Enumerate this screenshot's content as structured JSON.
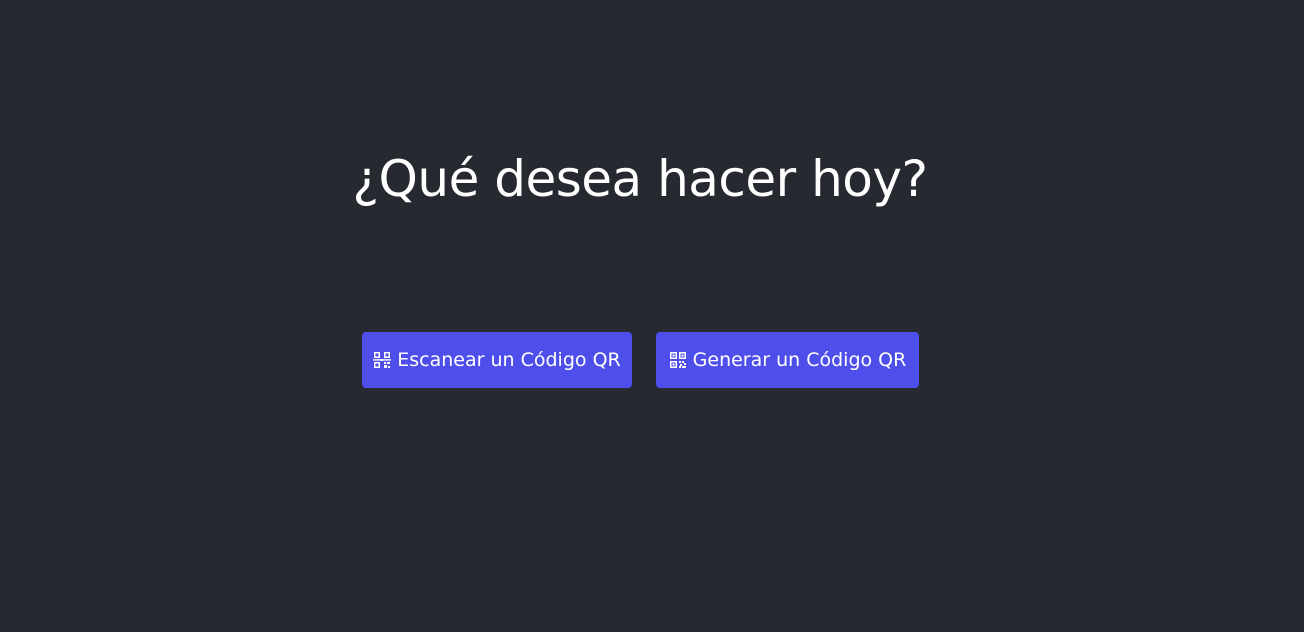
{
  "main": {
    "title": "¿Qué desea hacer hoy?"
  },
  "actions": {
    "scan": {
      "label": "Escanear un Código QR",
      "icon": "qr-scan-icon"
    },
    "generate": {
      "label": "Generar un Código QR",
      "icon": "qr-code-icon"
    }
  },
  "colors": {
    "background": "#26292f",
    "button": "#4e4eea",
    "text": "#ffffff"
  }
}
